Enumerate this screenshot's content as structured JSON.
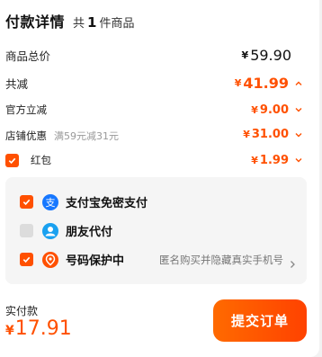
{
  "header": {
    "title": "付款详情",
    "count_prefix": "共",
    "count": "1",
    "count_suffix": "件商品"
  },
  "lines": {
    "subtotal": {
      "label": "商品总价",
      "currency": "¥",
      "amount": "59.90"
    },
    "discount_total": {
      "label": "共减",
      "currency": "¥",
      "amount": "41.99"
    },
    "official_discount": {
      "label": "官方立减",
      "currency": "¥",
      "amount": "9.00"
    },
    "store_discount": {
      "label": "店铺优惠",
      "note": "满59元减31元",
      "currency": "¥",
      "amount": "31.00"
    },
    "red_packet": {
      "label": "红包",
      "checked": true,
      "currency": "¥",
      "amount": "1.99"
    }
  },
  "services": [
    {
      "label": "支付宝免密支付",
      "checked": true,
      "icon": "alipay-icon",
      "icon_color": "#1677ff"
    },
    {
      "label": "朋友代付",
      "checked": false,
      "icon": "friend-pay-icon",
      "icon_color": "#1aa1f0"
    },
    {
      "label": "号码保护中",
      "checked": true,
      "icon": "number-protect-icon",
      "icon_color": "#ff5000",
      "note": "匿名购买并隐藏真实手机号"
    }
  ],
  "footer": {
    "pay_label": "实付款",
    "currency": "¥",
    "amount": "17.91",
    "submit_label": "提交订单"
  },
  "colors": {
    "accent": "#ff5000",
    "checkbox_off": "#dcdcdc",
    "background": "#f2f2f2"
  }
}
